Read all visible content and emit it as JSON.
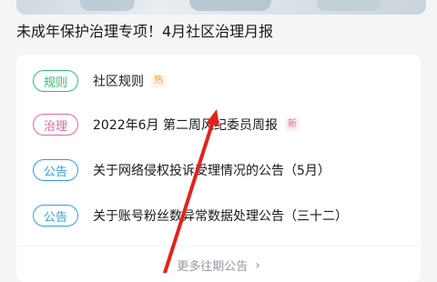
{
  "headline": "未成年保护治理专项！4月社区治理月报",
  "items": [
    {
      "tag": "规则",
      "text": "社区规则",
      "badge": "热"
    },
    {
      "tag": "治理",
      "text": "2022年6月 第二周风纪委员周报",
      "badge": "新"
    },
    {
      "tag": "公告",
      "text": "关于网络侵权投诉受理情况的公告（5月）",
      "badge": ""
    },
    {
      "tag": "公告",
      "text": "关于账号粉丝数异常数据处理公告（三十二）",
      "badge": ""
    }
  ],
  "more_label": "更多往期公告",
  "colors": {
    "rule_green": "#2bbf6b",
    "governance_pink": "#e5679a",
    "announcement_blue": "#2e9fe0",
    "annotation_arrow_red": "#e0241b"
  }
}
